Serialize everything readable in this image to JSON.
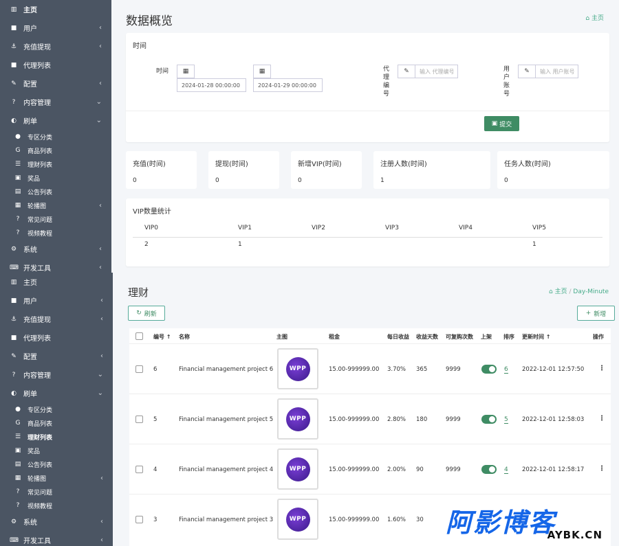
{
  "sidebar_top": [
    {
      "icon": "chart-bar-icon",
      "glyph": "▥",
      "label": "主页",
      "arrow": "",
      "bold": true
    },
    {
      "icon": "user-icon",
      "glyph": "■",
      "label": "用户",
      "arrow": "‹"
    },
    {
      "icon": "anchor-icon",
      "glyph": "⚓",
      "label": "充值提现",
      "arrow": "‹"
    },
    {
      "icon": "user-box-icon",
      "glyph": "■",
      "label": "代理列表",
      "arrow": ""
    },
    {
      "icon": "wrench-icon",
      "glyph": "✎",
      "label": "配置",
      "arrow": "‹"
    },
    {
      "icon": "question-icon",
      "glyph": "?",
      "label": "内容管理",
      "arrow": "⌄"
    },
    {
      "icon": "half-circle-icon",
      "glyph": "◐",
      "label": "刷单",
      "arrow": "⌄"
    },
    {
      "icon": "dot-icon",
      "glyph": "●",
      "label": "专区分类",
      "arrow": "",
      "sub": true
    },
    {
      "icon": "g-icon",
      "glyph": "G",
      "label": "商品列表",
      "arrow": "",
      "sub": true
    },
    {
      "icon": "list-icon",
      "glyph": "☰",
      "label": "理财列表",
      "arrow": "",
      "sub": true
    },
    {
      "icon": "money-icon",
      "glyph": "▣",
      "label": "奖品",
      "arrow": "",
      "sub": true
    },
    {
      "icon": "doc-icon",
      "glyph": "▤",
      "label": "公告列表",
      "arrow": "",
      "sub": true
    },
    {
      "icon": "image-icon",
      "glyph": "▦",
      "label": "轮播图",
      "arrow": "‹",
      "sub": true
    },
    {
      "icon": "question-icon",
      "glyph": "?",
      "label": "常见问题",
      "arrow": "",
      "sub": true
    },
    {
      "icon": "question-icon",
      "glyph": "?",
      "label": "视频教程",
      "arrow": "",
      "sub": true
    },
    {
      "icon": "gear-icon",
      "glyph": "⚙",
      "label": "系统",
      "arrow": "‹"
    },
    {
      "icon": "keyboard-icon",
      "glyph": "⌨",
      "label": "开发工具",
      "arrow": "‹"
    }
  ],
  "sidebar_bottom": [
    {
      "icon": "chart-bar-icon",
      "glyph": "▥",
      "label": "主页",
      "arrow": ""
    },
    {
      "icon": "user-icon",
      "glyph": "■",
      "label": "用户",
      "arrow": "‹"
    },
    {
      "icon": "anchor-icon",
      "glyph": "⚓",
      "label": "充值提现",
      "arrow": "‹"
    },
    {
      "icon": "user-box-icon",
      "glyph": "■",
      "label": "代理列表",
      "arrow": ""
    },
    {
      "icon": "wrench-icon",
      "glyph": "✎",
      "label": "配置",
      "arrow": "‹"
    },
    {
      "icon": "question-icon",
      "glyph": "?",
      "label": "内容管理",
      "arrow": "⌄"
    },
    {
      "icon": "half-circle-icon",
      "glyph": "◐",
      "label": "刷单",
      "arrow": "⌄"
    },
    {
      "icon": "dot-icon",
      "glyph": "●",
      "label": "专区分类",
      "arrow": "",
      "sub": true
    },
    {
      "icon": "g-icon",
      "glyph": "G",
      "label": "商品列表",
      "arrow": "",
      "sub": true
    },
    {
      "icon": "list-icon",
      "glyph": "☰",
      "label": "理财列表",
      "arrow": "",
      "sub": true,
      "bold": true
    },
    {
      "icon": "money-icon",
      "glyph": "▣",
      "label": "奖品",
      "arrow": "",
      "sub": true
    },
    {
      "icon": "doc-icon",
      "glyph": "▤",
      "label": "公告列表",
      "arrow": "",
      "sub": true
    },
    {
      "icon": "image-icon",
      "glyph": "▦",
      "label": "轮播图",
      "arrow": "‹",
      "sub": true
    },
    {
      "icon": "question-icon",
      "glyph": "?",
      "label": "常见问题",
      "arrow": "",
      "sub": true
    },
    {
      "icon": "question-icon",
      "glyph": "?",
      "label": "视频教程",
      "arrow": "",
      "sub": true
    },
    {
      "icon": "gear-icon",
      "glyph": "⚙",
      "label": "系统",
      "arrow": "‹"
    },
    {
      "icon": "keyboard-icon",
      "glyph": "⌨",
      "label": "开发工具",
      "arrow": "‹"
    }
  ],
  "overview": {
    "title": "数据概览",
    "breadcrumb": "主页",
    "filter_title": "时间",
    "time_label": "时间",
    "start_date": "2024-01-28 00:00:00",
    "end_date": "2024-01-29 00:00:00",
    "agent_label": "代理编号",
    "agent_placeholder": "输入 代理编号",
    "user_label": "用户账号",
    "user_placeholder": "输入 用户账号",
    "submit": "提交"
  },
  "stats": [
    {
      "title": "充值(时间)",
      "value": "0"
    },
    {
      "title": "提现(时间)",
      "value": "0"
    },
    {
      "title": "新增VIP(时间)",
      "value": "0"
    },
    {
      "title": "注册人数(时间)",
      "value": "1"
    },
    {
      "title": "任务人数(时间)",
      "value": "0"
    }
  ],
  "vip": {
    "title": "VIP数量统计",
    "headers": [
      "VIP0",
      "VIP1",
      "VIP2",
      "VIP3",
      "VIP4",
      "VIP5"
    ],
    "values": [
      "2",
      "1",
      "",
      "",
      "",
      "1"
    ]
  },
  "finance": {
    "title": "理财",
    "breadcrumb_home": "主页",
    "breadcrumb_current": "Day-Minute",
    "refresh": "刷新",
    "add": "新增",
    "headers": [
      "编号",
      "名称",
      "主图",
      "租金",
      "每日收益",
      "收益天数",
      "可复购次数",
      "上架",
      "排序",
      "更新时间",
      "操作"
    ],
    "rows": [
      {
        "id": "6",
        "name": "Financial management project 6",
        "img": "WPP",
        "price": "15.00-999999.00",
        "daily": "3.70%",
        "days": "365",
        "rebuy": "9999",
        "sort": "6",
        "updated": "2022-12-01 12:57:50"
      },
      {
        "id": "5",
        "name": "Financial management project 5",
        "img": "WPP",
        "price": "15.00-999999.00",
        "daily": "2.80%",
        "days": "180",
        "rebuy": "9999",
        "sort": "5",
        "updated": "2022-12-01 12:58:03"
      },
      {
        "id": "4",
        "name": "Financial management project 4",
        "img": "WPP",
        "price": "15.00-999999.00",
        "daily": "2.00%",
        "days": "90",
        "rebuy": "9999",
        "sort": "4",
        "updated": "2022-12-01 12:58:17"
      },
      {
        "id": "3",
        "name": "Financial management project 3",
        "img": "WPP",
        "price": "15.00-999999.00",
        "daily": "1.60%",
        "days": "30",
        "rebuy": "",
        "sort": "",
        "updated": ""
      }
    ]
  },
  "watermark": {
    "big": "阿影博客",
    "small": "AYBK.CN"
  }
}
